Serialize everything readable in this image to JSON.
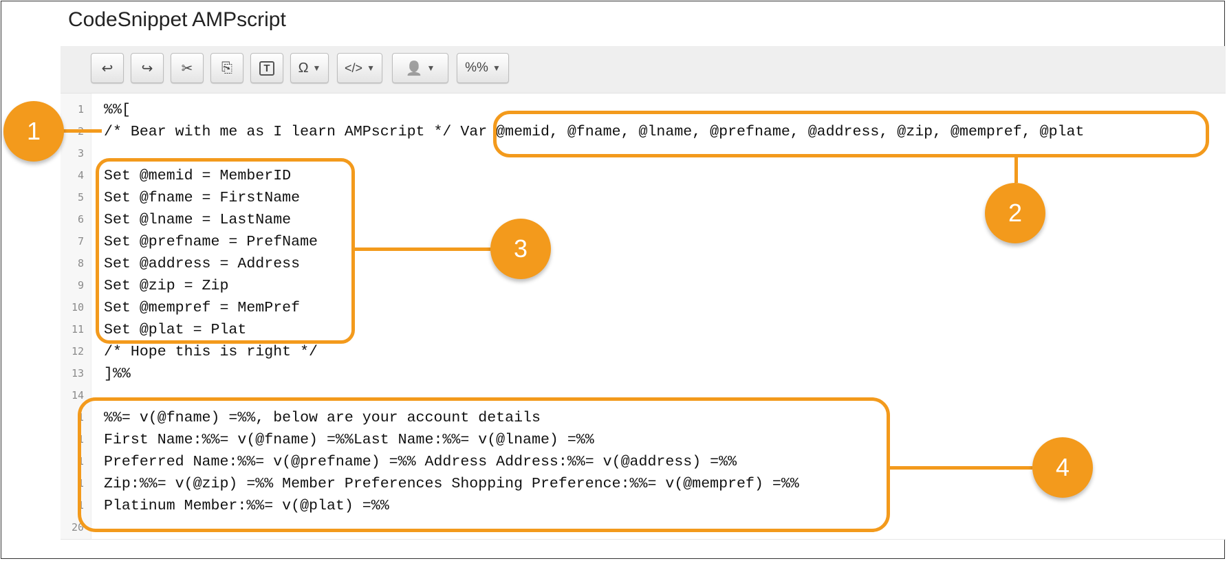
{
  "window": {
    "title": "CodeSnippet AMPscript"
  },
  "toolbar": {
    "buttons": [
      {
        "icon": "undo-icon",
        "glyph": "↩"
      },
      {
        "icon": "redo-icon",
        "glyph": "↪"
      },
      {
        "icon": "cut-icon",
        "glyph": "✂"
      },
      {
        "icon": "copy-icon",
        "glyph": "⎘"
      },
      {
        "icon": "paste-text-icon",
        "glyph": "T"
      },
      {
        "icon": "special-char-icon",
        "label": "Ω"
      },
      {
        "icon": "code-icon",
        "label": "</>"
      },
      {
        "icon": "personalization-icon",
        "glyph": "👤"
      },
      {
        "icon": "ampscript-icon",
        "label": "%%"
      }
    ]
  },
  "editor": {
    "line_numbers": [
      "1",
      "2",
      "3",
      "4",
      "5",
      "6",
      "7",
      "8",
      "9",
      "10",
      "11",
      "12",
      "13",
      "14",
      "1",
      "1",
      "1",
      "1",
      "1",
      "20"
    ],
    "lines": [
      "%%[",
      "/* Bear with me as I learn AMPscript */ Var @memid, @fname, @lname, @prefname, @address, @zip, @mempref, @plat",
      "",
      "Set @memid = MemberID",
      "Set @fname = FirstName",
      "Set @lname = LastName",
      "Set @prefname = PrefName",
      "Set @address = Address",
      "Set @zip = Zip",
      "Set @mempref = MemPref",
      "Set @plat = Plat",
      "/* Hope this is right */",
      "]%%",
      "",
      "%%= v(@fname) =%%, below are your account details",
      "First Name:%%= v(@fname) =%%Last Name:%%= v(@lname) =%%",
      "Preferred Name:%%= v(@prefname) =%% Address Address:%%= v(@address) =%%",
      "Zip:%%= v(@zip) =%% Member Preferences Shopping Preference:%%= v(@mempref) =%%",
      "Platinum Member:%%= v(@plat) =%%",
      ""
    ]
  },
  "callouts": {
    "one": "1",
    "two": "2",
    "three": "3",
    "four": "4"
  },
  "colors": {
    "accent": "#f39a1c"
  }
}
